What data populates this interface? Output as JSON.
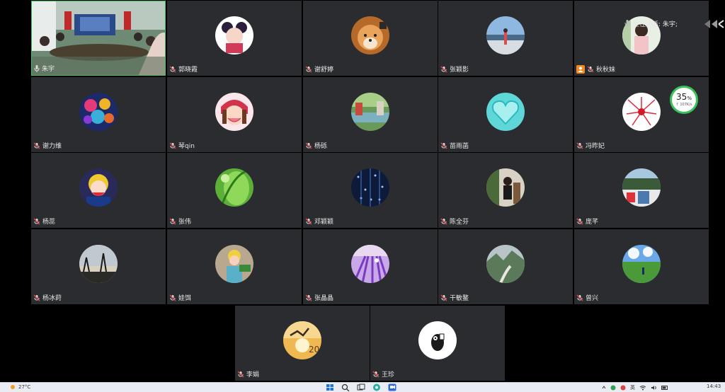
{
  "speaking_indicator": {
    "text": "正在讲话: 朱宇;"
  },
  "network_badge": {
    "percent": "35",
    "unit": "%",
    "speed": "↑ 107K/s"
  },
  "participants": [
    {
      "name": "朱宇"
    },
    {
      "name": "郭晓霞"
    },
    {
      "name": "谢舒婷"
    },
    {
      "name": "张颖影"
    },
    {
      "name": "秋秋妹"
    },
    {
      "name": "谢力维"
    },
    {
      "name": "琴qin"
    },
    {
      "name": "杨砾"
    },
    {
      "name": "苗雨菡"
    },
    {
      "name": "冯昨妃"
    },
    {
      "name": "杨蕊"
    },
    {
      "name": "张伟"
    },
    {
      "name": "邓颖颖"
    },
    {
      "name": "陈全芬"
    },
    {
      "name": "庞芊"
    },
    {
      "name": "杨冰莳"
    },
    {
      "name": "娃饵"
    },
    {
      "name": "张晶晶"
    },
    {
      "name": "干敏鳌"
    },
    {
      "name": "曾兴"
    },
    {
      "name": "李娟"
    },
    {
      "name": "王珍"
    }
  ],
  "taskbar": {
    "weather": "27°C",
    "language": "英",
    "time": "14:43"
  }
}
